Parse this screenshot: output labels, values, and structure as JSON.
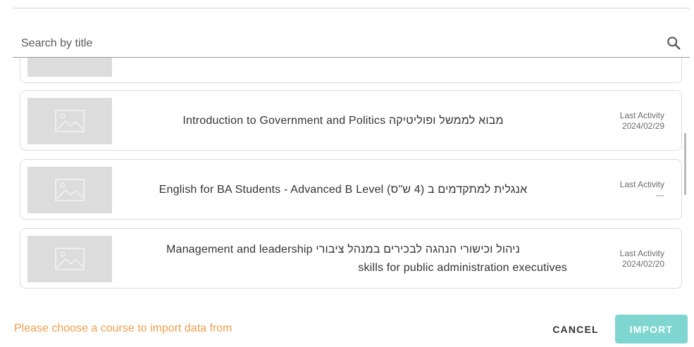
{
  "search": {
    "placeholder": "Search by title"
  },
  "courses": [
    {
      "title_line1": "Introduction to Government and Politics  מבוא לממשל ופוליטיקה",
      "title_line2": "",
      "activity_label": "Last Activity",
      "activity_value": "2024/02/29"
    },
    {
      "title_line1": "English for BA Students - Advanced B Level  (אנגלית למתקדמים ב (4 ש\"ס",
      "title_line2": "",
      "activity_label": "Last Activity",
      "activity_value": "---"
    },
    {
      "title_line1": "Management and leadership    ניהול וכישורי הנהגה לבכירים במנהל ציבורי",
      "title_line2": "skills for public administration executives",
      "activity_label": "Last Activity",
      "activity_value": "2024/02/20"
    }
  ],
  "footer": {
    "status": "Please choose a course to import data from",
    "cancel_label": "CANCEL",
    "import_label": "IMPORT"
  },
  "colors": {
    "accent": "#7fd6d1",
    "warning": "#f0a050"
  },
  "icons": {
    "search": "search-icon",
    "thumbnail": "image-placeholder-icon"
  }
}
